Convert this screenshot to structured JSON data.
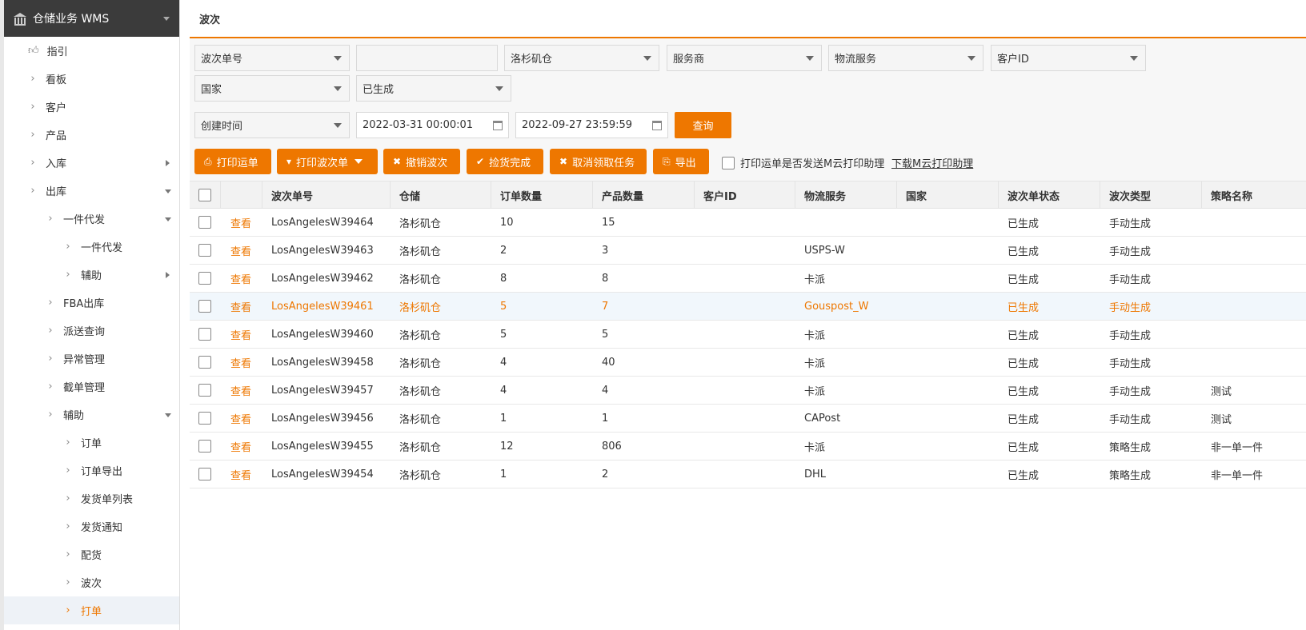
{
  "sidebar": {
    "title": "仓储业务 WMS",
    "items": [
      {
        "label": "指引",
        "level": 0,
        "icon": "thumbs-up-icon"
      },
      {
        "label": "看板",
        "level": 0
      },
      {
        "label": "客户",
        "level": 0
      },
      {
        "label": "产品",
        "level": 0
      },
      {
        "label": "入库",
        "level": 0,
        "arrow": "right"
      },
      {
        "label": "出库",
        "level": 0,
        "arrow": "down"
      },
      {
        "label": "一件代发",
        "level": 1,
        "arrow": "down"
      },
      {
        "label": "一件代发",
        "level": 2
      },
      {
        "label": "辅助",
        "level": 2,
        "arrow": "right"
      },
      {
        "label": "FBA出库",
        "level": 1
      },
      {
        "label": "派送查询",
        "level": 1
      },
      {
        "label": "异常管理",
        "level": 1
      },
      {
        "label": "截单管理",
        "level": 1
      },
      {
        "label": "辅助",
        "level": 1,
        "arrow": "down"
      },
      {
        "label": "订单",
        "level": 2
      },
      {
        "label": "订单导出",
        "level": 2
      },
      {
        "label": "发货单列表",
        "level": 2
      },
      {
        "label": "发货通知",
        "level": 2
      },
      {
        "label": "配货",
        "level": 2
      },
      {
        "label": "波次",
        "level": 2
      },
      {
        "label": "打单",
        "level": 2,
        "active": true
      }
    ]
  },
  "page": {
    "title": "波次"
  },
  "filters": {
    "batch_no_select": "波次单号",
    "batch_no_value": "",
    "warehouse": "洛杉矶仓",
    "provider": "服务商",
    "logistics": "物流服务",
    "customer_id": "客户ID",
    "country": "国家",
    "status": "已生成",
    "time_type": "创建时间",
    "start_time": "2022-03-31 00:00:01",
    "end_time": "2022-09-27 23:59:59",
    "query_label": "查询"
  },
  "toolbar": {
    "print_waybill": "打印运单",
    "print_batch": "打印波次单",
    "cancel_batch": "撤销波次",
    "pick_done": "捡货完成",
    "cancel_task": "取消领取任务",
    "export": "导出",
    "send_cloud_label": "打印运单是否发送M云打印助理",
    "download_link": "下载M云打印助理"
  },
  "table": {
    "headers": [
      "波次单号",
      "仓储",
      "订单数量",
      "产品数量",
      "客户ID",
      "物流服务",
      "国家",
      "波次单状态",
      "波次类型",
      "策略名称"
    ],
    "view_label": "查看",
    "rows": [
      {
        "no": "LosAngelesW39464",
        "wh": "洛杉矶仓",
        "orders": "10",
        "products": "15",
        "cid": "",
        "logistics": "",
        "country": "",
        "status": "已生成",
        "type": "手动生成",
        "strategy": ""
      },
      {
        "no": "LosAngelesW39463",
        "wh": "洛杉矶仓",
        "orders": "2",
        "products": "3",
        "cid": "",
        "logistics": "USPS-W",
        "country": "",
        "status": "已生成",
        "type": "手动生成",
        "strategy": ""
      },
      {
        "no": "LosAngelesW39462",
        "wh": "洛杉矶仓",
        "orders": "8",
        "products": "8",
        "cid": "",
        "logistics": "卡派",
        "country": "",
        "status": "已生成",
        "type": "手动生成",
        "strategy": ""
      },
      {
        "no": "LosAngelesW39461",
        "wh": "洛杉矶仓",
        "orders": "5",
        "products": "7",
        "cid": "",
        "logistics": "Gouspost_W",
        "country": "",
        "status": "已生成",
        "type": "手动生成",
        "strategy": "",
        "highlight": true
      },
      {
        "no": "LosAngelesW39460",
        "wh": "洛杉矶仓",
        "orders": "5",
        "products": "5",
        "cid": "",
        "logistics": "卡派",
        "country": "",
        "status": "已生成",
        "type": "手动生成",
        "strategy": ""
      },
      {
        "no": "LosAngelesW39458",
        "wh": "洛杉矶仓",
        "orders": "4",
        "products": "40",
        "cid": "",
        "logistics": "卡派",
        "country": "",
        "status": "已生成",
        "type": "手动生成",
        "strategy": ""
      },
      {
        "no": "LosAngelesW39457",
        "wh": "洛杉矶仓",
        "orders": "4",
        "products": "4",
        "cid": "",
        "logistics": "卡派",
        "country": "",
        "status": "已生成",
        "type": "手动生成",
        "strategy": "测试"
      },
      {
        "no": "LosAngelesW39456",
        "wh": "洛杉矶仓",
        "orders": "1",
        "products": "1",
        "cid": "",
        "logistics": "CAPost",
        "country": "",
        "status": "已生成",
        "type": "手动生成",
        "strategy": "测试"
      },
      {
        "no": "LosAngelesW39455",
        "wh": "洛杉矶仓",
        "orders": "12",
        "products": "806",
        "cid": "",
        "logistics": "卡派",
        "country": "",
        "status": "已生成",
        "type": "策略生成",
        "strategy": "非一单一件"
      },
      {
        "no": "LosAngelesW39454",
        "wh": "洛杉矶仓",
        "orders": "1",
        "products": "2",
        "cid": "",
        "logistics": "DHL",
        "country": "",
        "status": "已生成",
        "type": "策略生成",
        "strategy": "非一单一件"
      }
    ]
  },
  "colors": {
    "accent": "#ee7700",
    "sidebar_header": "#3b3b3b"
  }
}
